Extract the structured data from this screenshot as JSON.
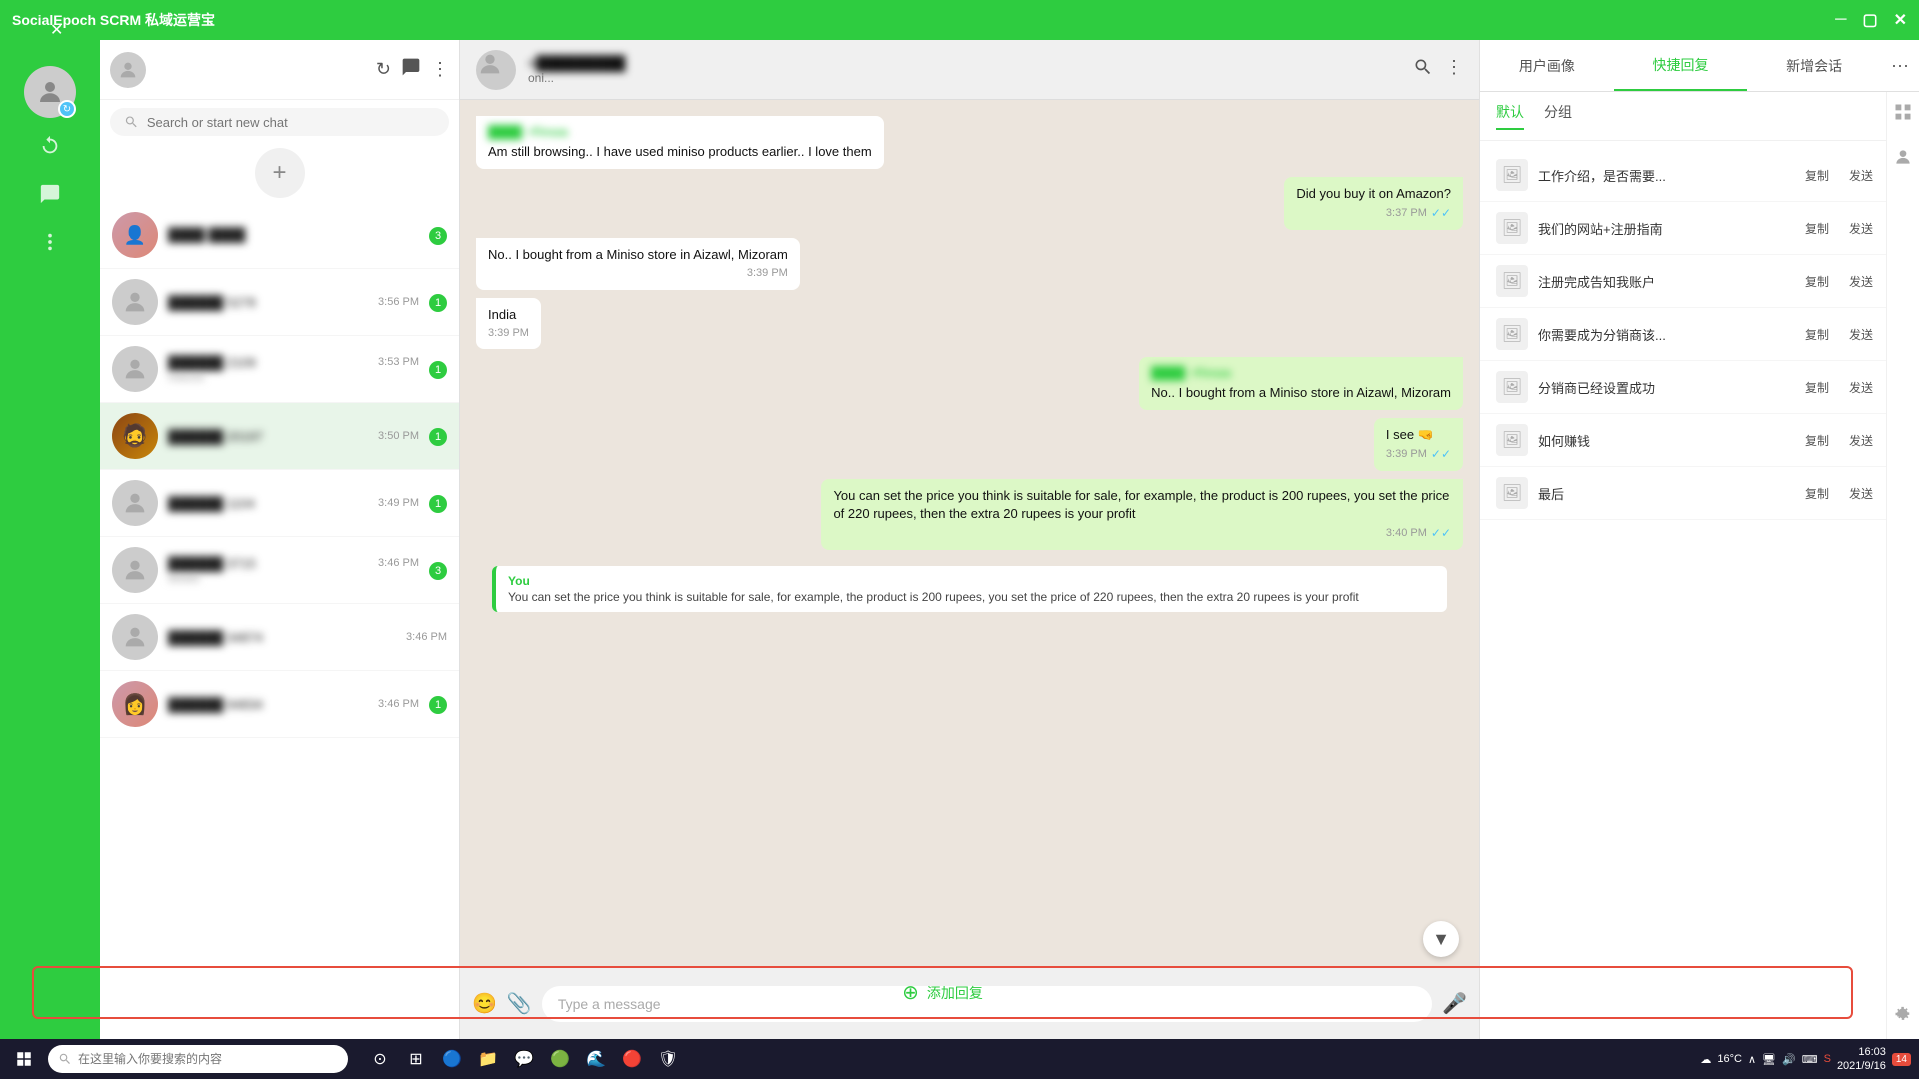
{
  "app": {
    "title": "SocialEpoch SCRM 私域运营宝",
    "title_controls": [
      "minimize",
      "maximize",
      "close"
    ]
  },
  "sidebar": {
    "close_label": "×"
  },
  "chat_list": {
    "search_placeholder": "Search or start new chat",
    "add_button_label": "+",
    "items": [
      {
        "id": 1,
        "name": "████ ████",
        "time": "",
        "preview": "",
        "unread": 3,
        "has_photo": true
      },
      {
        "id": 2,
        "name": "██████ 5278",
        "time": "3:56 PM",
        "preview": "",
        "unread": 1,
        "has_photo": false
      },
      {
        "id": 3,
        "name": "██████ 2109",
        "time": "3:53 PM",
        "preview": "roducts",
        "unread": 1,
        "has_photo": false
      },
      {
        "id": 4,
        "name": "██████ 20197",
        "time": "3:50 PM",
        "preview": "",
        "unread": 1,
        "has_photo": true
      },
      {
        "id": 5,
        "name": "██████ 1104",
        "time": "3:49 PM",
        "preview": "",
        "unread": 1,
        "has_photo": false
      },
      {
        "id": 6,
        "name": "██████ 3715",
        "time": "3:46 PM",
        "preview": "details",
        "unread": 3,
        "has_photo": false
      },
      {
        "id": 7,
        "name": "██████ 34874",
        "time": "3:46 PM",
        "preview": "",
        "unread": 0,
        "has_photo": false
      },
      {
        "id": 8,
        "name": "██████ 94834",
        "time": "3:46 PM",
        "preview": "",
        "unread": 1,
        "has_photo": true
      }
    ]
  },
  "chat_header": {
    "name": "██████████",
    "status": "oni...",
    "phone": "+█████████"
  },
  "messages": [
    {
      "id": 1,
      "type": "incoming",
      "sender": "████ ~Firoza",
      "text": "Am still browsing.. I have used miniso products earlier.. I love them",
      "time": "",
      "ticks": ""
    },
    {
      "id": 2,
      "type": "outgoing",
      "sender": "",
      "text": "Did you buy it on Amazon?",
      "time": "3:37 PM",
      "ticks": "✓✓"
    },
    {
      "id": 3,
      "type": "incoming",
      "sender": "",
      "text": "No.. I bought from a Miniso store in Aizawl, Mizoram",
      "time": "3:39 PM",
      "ticks": ""
    },
    {
      "id": 4,
      "type": "incoming",
      "sender": "",
      "text": "India",
      "time": "3:39 PM",
      "ticks": ""
    },
    {
      "id": 5,
      "type": "outgoing",
      "sender": "████ ~Firoza",
      "text": "No.. I bought from a Miniso store in Aizawl, Mizoram",
      "time": "",
      "ticks": ""
    },
    {
      "id": 6,
      "type": "outgoing",
      "sender": "",
      "text": "I see 🤜",
      "time": "3:39 PM",
      "ticks": "✓✓"
    },
    {
      "id": 7,
      "type": "outgoing",
      "sender": "",
      "text": "You can set the price you think is suitable for sale, for example, the product is 200 rupees, you set the price of 220 rupees, then the extra 20 rupees is your profit",
      "time": "3:40 PM",
      "ticks": "✓✓"
    }
  ],
  "preview_card": {
    "sender": "You",
    "text": "You can set the price you think is suitable for sale, for example, the product is 200 rupees, you set the price of 220 rupees, then the extra 20 rupees is your profit"
  },
  "message_input": {
    "placeholder": "Type a message"
  },
  "right_panel": {
    "tabs": [
      "用户画像",
      "快捷回复",
      "新增会话"
    ],
    "active_tab": "快捷回复",
    "sub_tabs": [
      "默认",
      "分组"
    ],
    "active_sub_tab": "默认",
    "quick_replies": [
      {
        "id": 1,
        "text": "工作介绍，是否需要..."
      },
      {
        "id": 2,
        "text": "我们的网站+注册指南"
      },
      {
        "id": 3,
        "text": "注册完成告知我账户"
      },
      {
        "id": 4,
        "text": "你需要成为分销商该..."
      },
      {
        "id": 5,
        "text": "分销商已经设置成功"
      },
      {
        "id": 6,
        "text": "如何赚钱"
      },
      {
        "id": 7,
        "text": "最后"
      }
    ],
    "copy_label": "复制",
    "send_label": "发送",
    "add_reply_label": "添加回复"
  },
  "taskbar": {
    "search_placeholder": "在这里输入你要搜索的内容",
    "time": "16:03",
    "date": "2021/9/16",
    "notification_count": "14",
    "temp": "16°C"
  }
}
